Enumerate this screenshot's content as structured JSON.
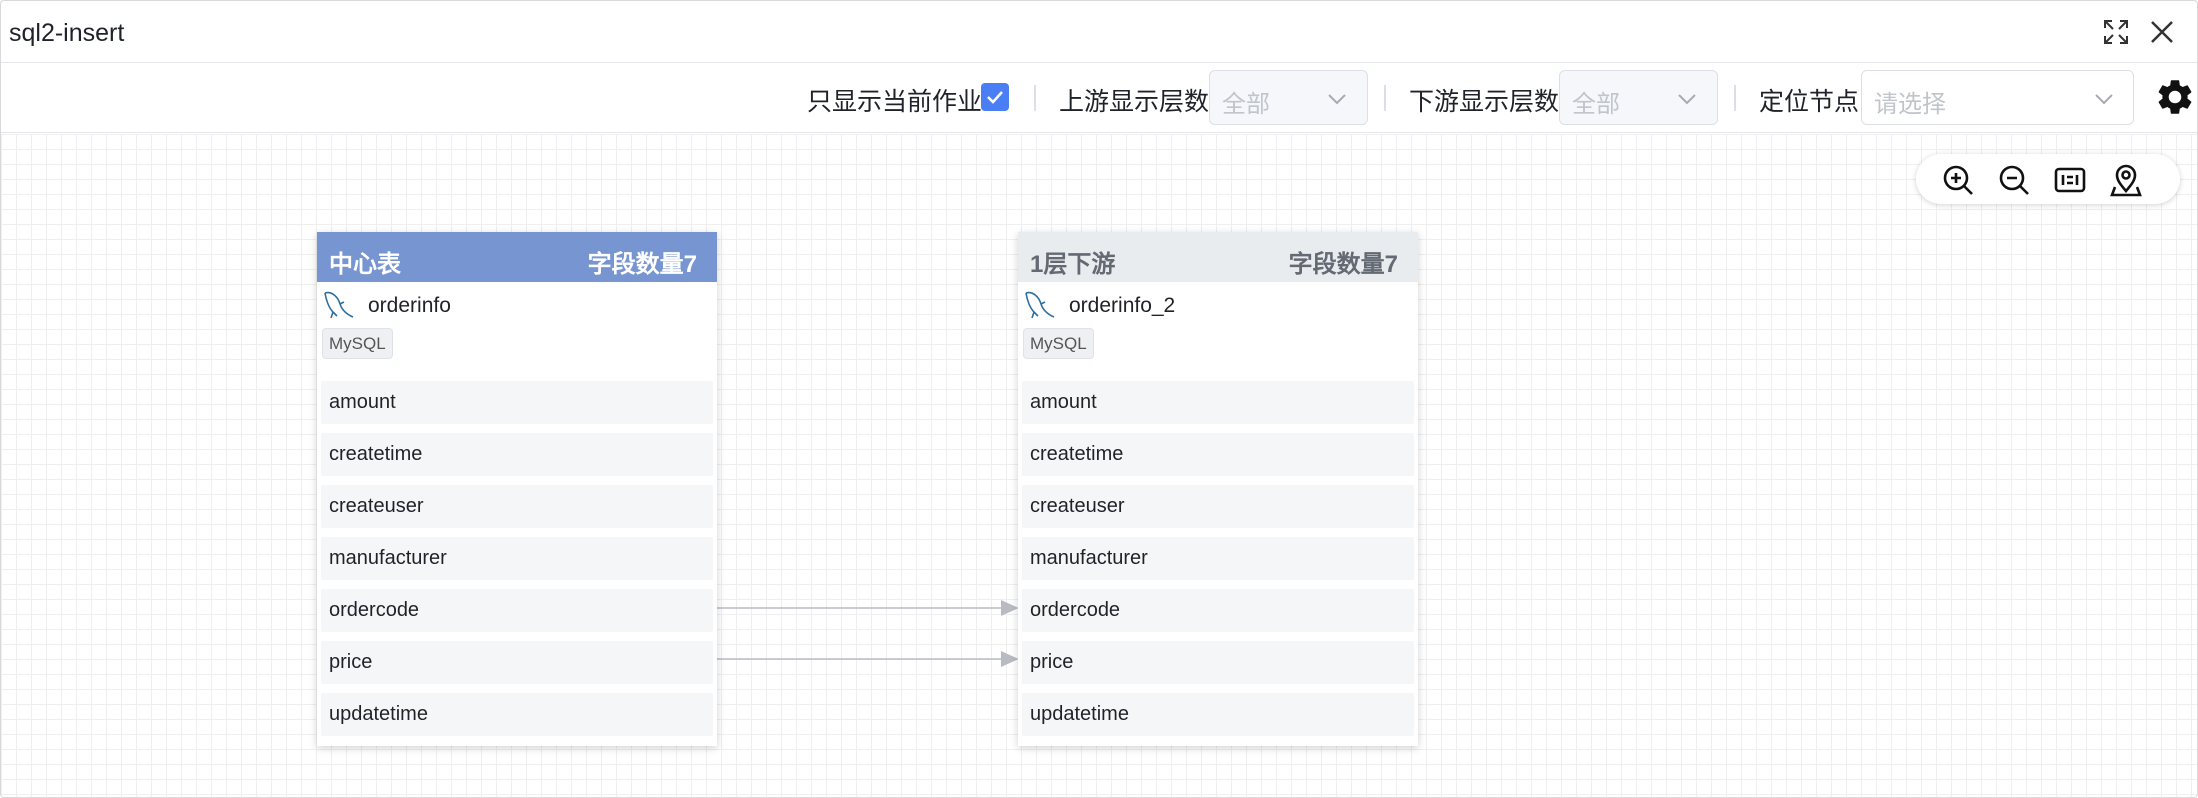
{
  "window": {
    "title": "sql2-insert"
  },
  "toolbar": {
    "current_job_label": "只显示当前作业",
    "current_job_checked": true,
    "upstream_label": "上游显示层数",
    "upstream_value": "全部",
    "downstream_label": "下游显示层数",
    "downstream_value": "全部",
    "locate_label": "定位节点",
    "locate_placeholder": "请选择"
  },
  "icons": {
    "maximize": "fullscreen-icon",
    "close": "close-icon",
    "settings": "gear-icon",
    "zoom_in": "zoom-in-icon",
    "zoom_out": "zoom-out-icon",
    "fit": "fit-view-icon",
    "locate": "location-pin-icon"
  },
  "colors": {
    "center_header": "#7795d0",
    "downstream_header": "#e9ecef",
    "checkbox": "#4a7ef5",
    "edge": "#b8bcc2"
  },
  "tables": [
    {
      "header_left": "中心表",
      "header_right": "字段数量7",
      "name": "orderinfo",
      "db": "MySQL",
      "fields": [
        "amount",
        "createtime",
        "createuser",
        "manufacturer",
        "ordercode",
        "price",
        "updatetime"
      ]
    },
    {
      "header_left": "1层下游",
      "header_right": "字段数量7",
      "name": "orderinfo_2",
      "db": "MySQL",
      "fields": [
        "amount",
        "createtime",
        "createuser",
        "manufacturer",
        "ordercode",
        "price",
        "updatetime"
      ]
    }
  ],
  "edges": [
    {
      "from": "orderinfo.ordercode",
      "to": "orderinfo_2.ordercode"
    },
    {
      "from": "orderinfo.price",
      "to": "orderinfo_2.price"
    }
  ]
}
